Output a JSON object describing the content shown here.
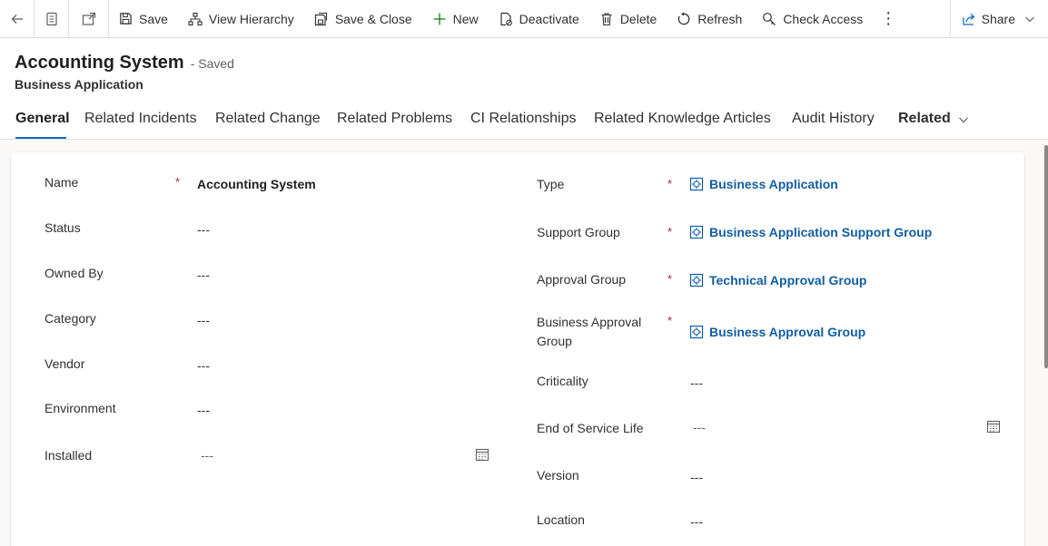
{
  "toolbar": {
    "save": "Save",
    "view_hierarchy": "View Hierarchy",
    "save_close": "Save & Close",
    "new": "New",
    "deactivate": "Deactivate",
    "delete": "Delete",
    "refresh": "Refresh",
    "check_access": "Check Access",
    "more": "⋮",
    "share": "Share"
  },
  "header": {
    "title": "Accounting System",
    "saved_state": "- Saved",
    "entity": "Business Application"
  },
  "tabs": [
    {
      "label": "General",
      "active": true
    },
    {
      "label": "Related Incidents"
    },
    {
      "label": "Related Change"
    },
    {
      "label": "Related Problems"
    },
    {
      "label": "CI Relationships"
    },
    {
      "label": "Related Knowledge Articles"
    },
    {
      "label": "Audit History"
    },
    {
      "label": "Related"
    }
  ],
  "left_fields": {
    "name": {
      "label": "Name",
      "value": "Accounting System",
      "required": "*"
    },
    "status": {
      "label": "Status",
      "value": "---"
    },
    "owned_by": {
      "label": "Owned By",
      "value": "---"
    },
    "category": {
      "label": "Category",
      "value": "---"
    },
    "vendor": {
      "label": "Vendor",
      "value": "---"
    },
    "environment": {
      "label": "Environment",
      "value": "---"
    },
    "installed": {
      "label": "Installed",
      "value": "---"
    }
  },
  "right_fields": {
    "type": {
      "label": "Type",
      "value": "Business Application",
      "required": "*"
    },
    "support_group": {
      "label": "Support Group",
      "value": "Business Application Support Group",
      "required": "*"
    },
    "approval_group": {
      "label": "Approval Group",
      "value": "Technical Approval Group",
      "required": "*"
    },
    "business_approval_group": {
      "label_line1": "Business Approval",
      "label_line2": "Group",
      "value": "Business Approval Group",
      "required": "*"
    },
    "criticality": {
      "label": "Criticality",
      "value": "---"
    },
    "end_of_service_life": {
      "label": "End of Service Life",
      "value": "---"
    },
    "version": {
      "label": "Version",
      "value": "---"
    },
    "location": {
      "label": "Location",
      "value": "---"
    }
  },
  "colors": {
    "accent": "#0f6cbd",
    "link": "#115ea3",
    "required": "#a4262c"
  }
}
